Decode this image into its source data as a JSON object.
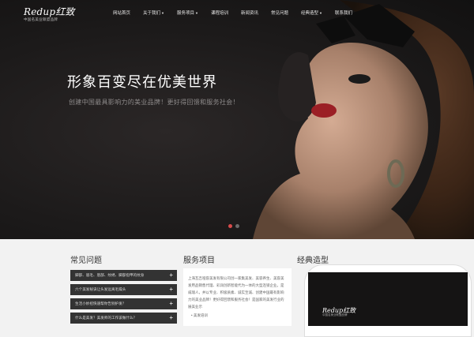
{
  "header": {
    "logo_text": "Redup红致",
    "logo_tagline": "中国名美业联盟品牌",
    "menu": [
      {
        "label": "网站首页",
        "has_dropdown": false
      },
      {
        "label": "关于我们",
        "has_dropdown": true
      },
      {
        "label": "服务项目",
        "has_dropdown": true
      },
      {
        "label": "课程培训",
        "has_dropdown": false
      },
      {
        "label": "新闻资讯",
        "has_dropdown": false
      },
      {
        "label": "常见问题",
        "has_dropdown": false
      },
      {
        "label": "经典造型",
        "has_dropdown": true
      },
      {
        "label": "联系我们",
        "has_dropdown": false
      }
    ]
  },
  "hero": {
    "title": "形象百变尽在优美世界",
    "subtitle": "创建中国最具影响力的美业品牌！更好得回馈和服务社会！",
    "slides_total": 2,
    "active_slide": 1
  },
  "faq": {
    "title": "常见问题",
    "items": [
      "脚部、眉毛、唇部、纹绣、脚部指甲的纹身",
      "六个美发秘诀让头发远离毛躁头",
      "生活小妙招快速帮你告别护发？",
      "什么是美发？美发师的工作该做什么？"
    ]
  },
  "services": {
    "title": "服务项目",
    "text": "上海瓦吉哑容美发有限公司创一家集美发、美容养生、美容美发用品销售代理、彩润创新智能代为一体的大型连锁企业。是威瑞人，并以专业、积极质素、诚实至诚、创建中国最有影响力的美业品牌！更好得回馈和服务社会！是国家的美发行业的展美业示",
    "bullet": "• 美发培训"
  },
  "gallery": {
    "title": "经典造型",
    "phone_logo": "Redup红致",
    "phone_tagline": "中国名美业联盟品牌"
  },
  "colors": {
    "hero_bg": "#1c1a1a",
    "faq_item_bg": "#333333",
    "active_dot": "#d84b4b"
  }
}
